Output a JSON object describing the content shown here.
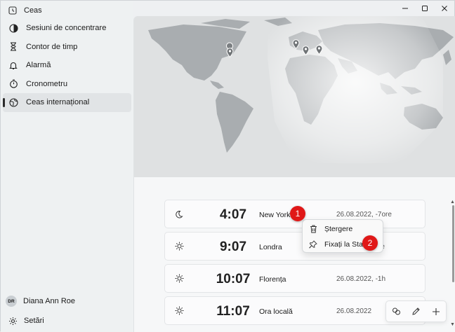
{
  "app": {
    "title": "Ceas"
  },
  "nav": {
    "items": [
      {
        "label": "Sesiuni de concentrare",
        "icon": "focus-icon"
      },
      {
        "label": "Contor de timp",
        "icon": "hourglass-icon"
      },
      {
        "label": "Alarmă",
        "icon": "bell-icon"
      },
      {
        "label": "Cronometru",
        "icon": "stopwatch-icon"
      },
      {
        "label": "Ceas internațional",
        "icon": "globe-icon",
        "active": true
      }
    ]
  },
  "user": {
    "initials": "DR",
    "name": "Diana Ann Roe"
  },
  "settings": {
    "label": "Setări"
  },
  "clocks": [
    {
      "time": "4:07",
      "city": "New York",
      "date": "26.08.2022, -7ore",
      "icon": "moon-icon"
    },
    {
      "time": "9:07",
      "city": "Londra",
      "date": "re",
      "icon": "sun-icon"
    },
    {
      "time": "10:07",
      "city": "Florența",
      "date": "26.08.2022, -1h",
      "icon": "sun-icon"
    },
    {
      "time": "11:07",
      "city": "Ora locală",
      "date": "26.08.2022",
      "icon": "sun-icon"
    }
  ],
  "context_menu": {
    "items": [
      {
        "label": "Ștergere",
        "icon": "trash-icon"
      },
      {
        "label": "Fixați la Start",
        "icon": "pin-icon"
      }
    ]
  },
  "markers": {
    "first": "1",
    "second": "2"
  },
  "colors": {
    "marker": "#e01818",
    "map_land": "#a9adb0",
    "map_bg": "#e4e6e7"
  }
}
